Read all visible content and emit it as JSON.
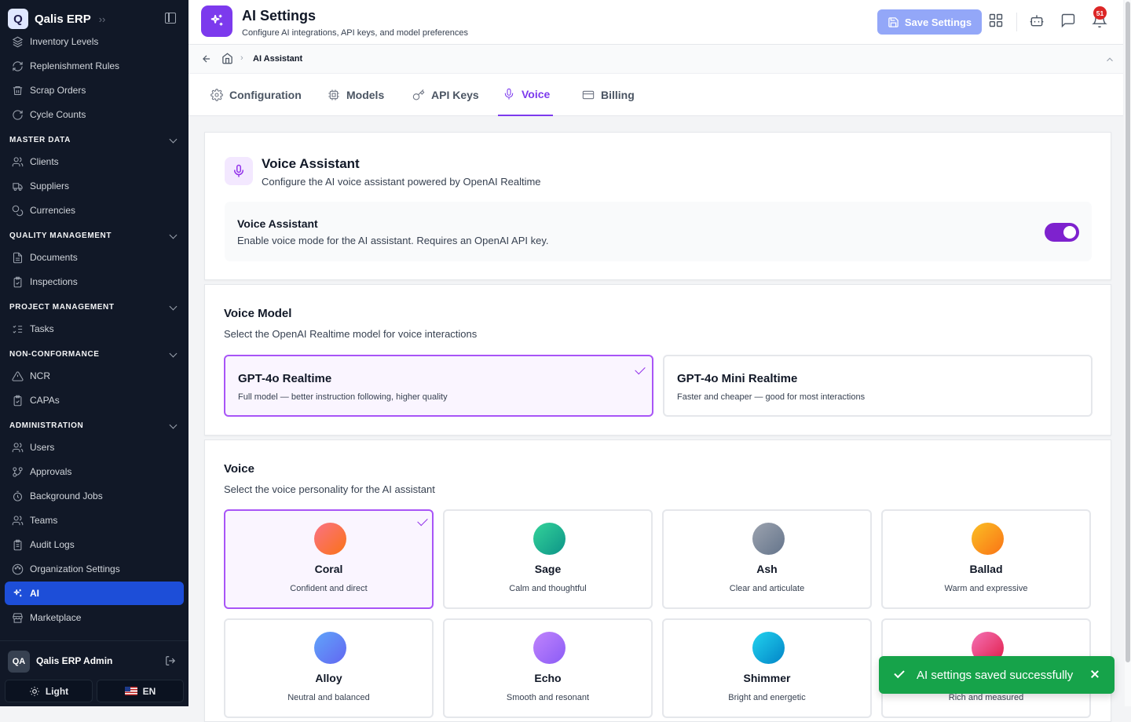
{
  "app": {
    "name": "Qalis ERP"
  },
  "sidebar": {
    "top_items": [
      {
        "label": "Inventory Levels",
        "icon": "layers-icon"
      },
      {
        "label": "Replenishment Rules",
        "icon": "refresh-icon"
      },
      {
        "label": "Scrap Orders",
        "icon": "trash-icon"
      },
      {
        "label": "Cycle Counts",
        "icon": "cycle-icon"
      }
    ],
    "sections": [
      {
        "title": "MASTER DATA",
        "items": [
          {
            "label": "Clients",
            "icon": "users-icon"
          },
          {
            "label": "Suppliers",
            "icon": "truck-icon"
          },
          {
            "label": "Currencies",
            "icon": "coins-icon"
          }
        ]
      },
      {
        "title": "QUALITY MANAGEMENT",
        "items": [
          {
            "label": "Documents",
            "icon": "document-icon"
          },
          {
            "label": "Inspections",
            "icon": "clipboard-check-icon"
          }
        ]
      },
      {
        "title": "PROJECT MANAGEMENT",
        "items": [
          {
            "label": "Tasks",
            "icon": "list-checks-icon"
          }
        ]
      },
      {
        "title": "NON-CONFORMANCE",
        "items": [
          {
            "label": "NCR",
            "icon": "warning-icon"
          },
          {
            "label": "CAPAs",
            "icon": "clipboard-check-icon"
          }
        ]
      },
      {
        "title": "ADMINISTRATION",
        "items": [
          {
            "label": "Users",
            "icon": "users-icon"
          },
          {
            "label": "Approvals",
            "icon": "git-branch-icon"
          },
          {
            "label": "Background Jobs",
            "icon": "timer-icon"
          },
          {
            "label": "Teams",
            "icon": "users-icon"
          },
          {
            "label": "Audit Logs",
            "icon": "clipboard-list-icon"
          },
          {
            "label": "Organization Settings",
            "icon": "palette-icon"
          },
          {
            "label": "AI",
            "icon": "sparkles-icon",
            "active": true
          },
          {
            "label": "Marketplace",
            "icon": "store-icon"
          }
        ]
      }
    ],
    "user": {
      "initials": "QA",
      "name": "Qalis ERP Admin"
    },
    "theme_label": "Light",
    "lang_label": "EN"
  },
  "header": {
    "title": "AI Settings",
    "subtitle": "Configure AI integrations, API keys, and model preferences",
    "save_label": "Save Settings",
    "notification_count": "51"
  },
  "breadcrumb": {
    "current": "AI Assistant"
  },
  "tabs": [
    {
      "label": "Configuration",
      "icon": "gear-icon"
    },
    {
      "label": "Models",
      "icon": "chip-icon"
    },
    {
      "label": "API Keys",
      "icon": "key-icon"
    },
    {
      "label": "Voice",
      "icon": "microphone-icon",
      "active": true
    },
    {
      "label": "Billing",
      "icon": "credit-card-icon"
    }
  ],
  "voice_assistant": {
    "title": "Voice Assistant",
    "subtitle": "Configure the AI voice assistant powered by OpenAI Realtime",
    "toggle_title": "Voice Assistant",
    "toggle_desc": "Enable voice mode for the AI assistant. Requires an OpenAI API key.",
    "enabled": true
  },
  "voice_model": {
    "title": "Voice Model",
    "subtitle": "Select the OpenAI Realtime model for voice interactions",
    "options": [
      {
        "name": "GPT-4o Realtime",
        "desc": "Full model — better instruction following, higher quality",
        "selected": true
      },
      {
        "name": "GPT-4o Mini Realtime",
        "desc": "Faster and cheaper — good for most interactions",
        "selected": false
      }
    ]
  },
  "voice": {
    "title": "Voice",
    "subtitle": "Select the voice personality for the AI assistant",
    "options": [
      {
        "name": "Coral",
        "desc": "Confident and direct",
        "color1": "#fb7185",
        "color2": "#f97316",
        "selected": true
      },
      {
        "name": "Sage",
        "desc": "Calm and thoughtful",
        "color1": "#34d399",
        "color2": "#0d9488",
        "selected": false
      },
      {
        "name": "Ash",
        "desc": "Clear and articulate",
        "color1": "#9ca3af",
        "color2": "#64748b",
        "selected": false
      },
      {
        "name": "Ballad",
        "desc": "Warm and expressive",
        "color1": "#fbbf24",
        "color2": "#f97316",
        "selected": false
      },
      {
        "name": "Alloy",
        "desc": "Neutral and balanced",
        "color1": "#60a5fa",
        "color2": "#6366f1",
        "selected": false
      },
      {
        "name": "Echo",
        "desc": "Smooth and resonant",
        "color1": "#c084fc",
        "color2": "#8b5cf6",
        "selected": false
      },
      {
        "name": "Shimmer",
        "desc": "Bright and energetic",
        "color1": "#22d3ee",
        "color2": "#0284c7",
        "selected": false
      },
      {
        "name": "",
        "desc": "Rich and measured",
        "color1": "#f472b6",
        "color2": "#e11d48",
        "selected": false
      }
    ]
  },
  "toast": {
    "message": "AI settings saved successfully"
  }
}
